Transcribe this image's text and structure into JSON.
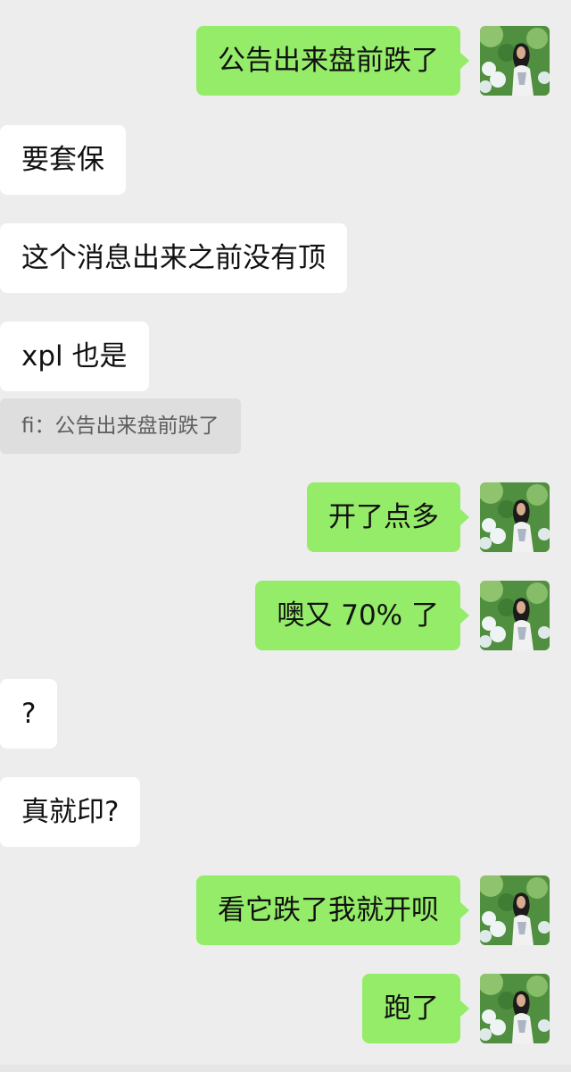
{
  "chat": {
    "messages": [
      {
        "side": "out",
        "text": "公告出来盘前跌了"
      },
      {
        "side": "in",
        "text": "要套保"
      },
      {
        "side": "in",
        "text": "这个消息出来之前没有顶"
      },
      {
        "side": "in",
        "text": "xpl 也是",
        "quote": "fi：公告出来盘前跌了"
      },
      {
        "side": "out",
        "text": "开了点多"
      },
      {
        "side": "out",
        "text": "噢又 70% 了"
      },
      {
        "side": "in",
        "text": "?"
      },
      {
        "side": "in",
        "text": "真就印?"
      },
      {
        "side": "out",
        "text": "看它跌了我就开呗"
      },
      {
        "side": "out",
        "text": "跑了"
      }
    ]
  },
  "avatar": {
    "icon": "user-photo-avatar",
    "colors": {
      "foliage": "#4f8f3f",
      "foliage_light": "#9fcf7a",
      "flowers": "#eef4f4",
      "shirt": "#f1f1f1",
      "hair": "#1b1b1b",
      "skin": "#d7ab8d"
    }
  },
  "theme": {
    "background": "#ededed",
    "incoming_bubble": "#ffffff",
    "outgoing_bubble": "#95ec69",
    "quote_bg": "#dedede"
  }
}
